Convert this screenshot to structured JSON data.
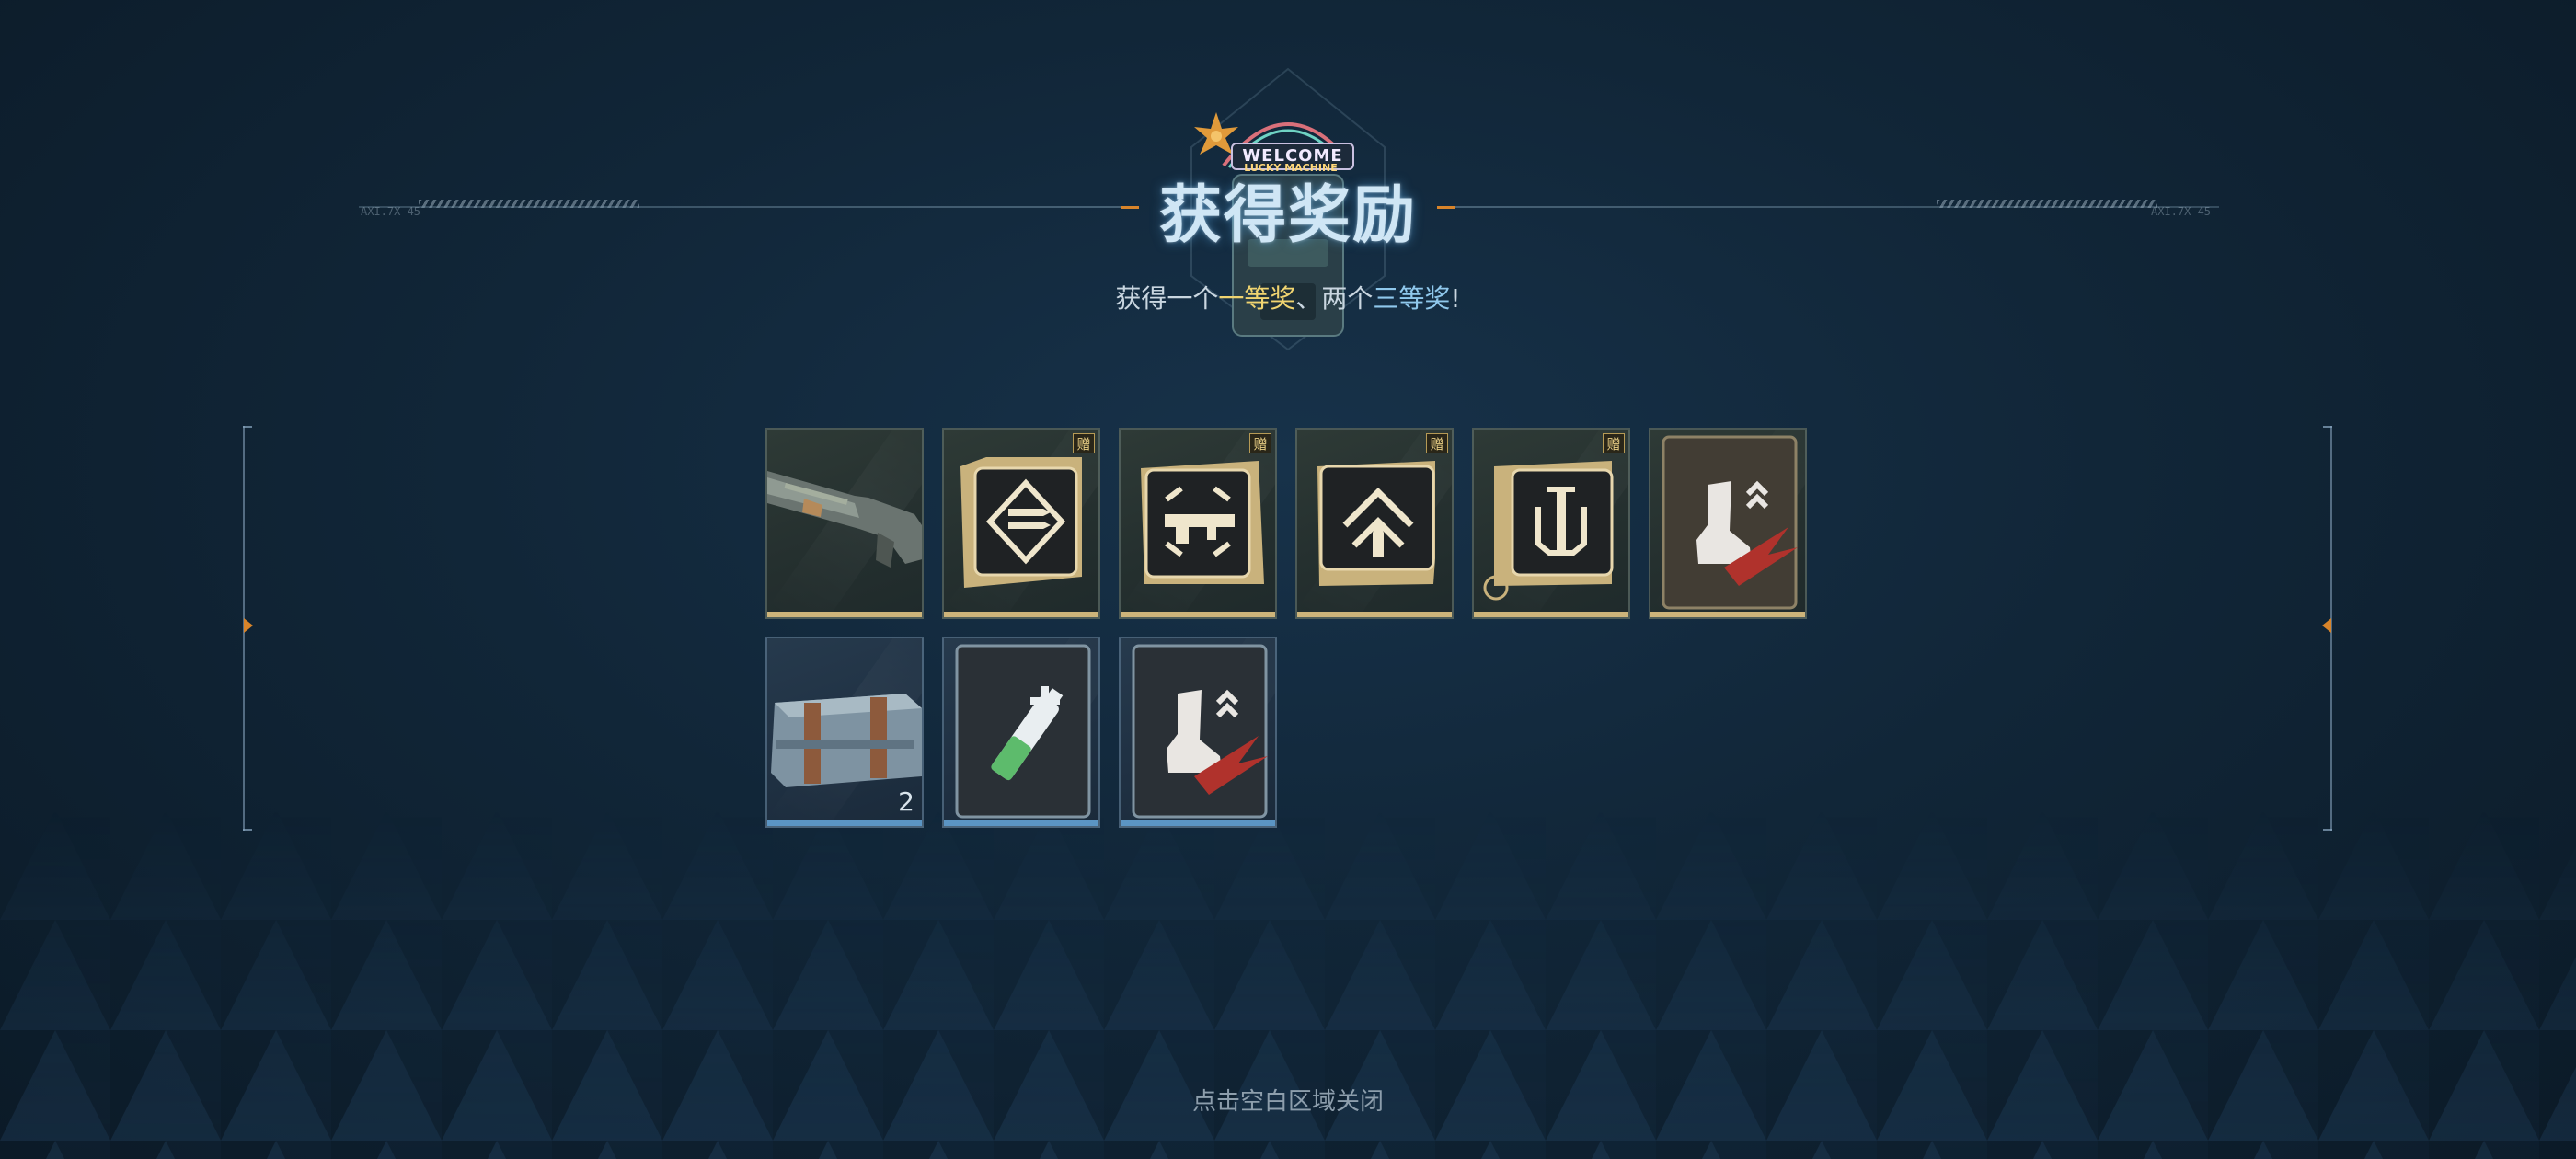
{
  "emblem": {
    "sign_text": "WELCOME",
    "sub_text": "LUCKY MACHINE"
  },
  "header": {
    "title": "获得奖励",
    "left_code": "AXI.7X-45",
    "right_code": "AXI.7X-45",
    "subtitle": {
      "prefix": "获得一个",
      "first_prize": "一等奖",
      "middle": "、两个",
      "third_prize": "三等奖",
      "suffix": "!"
    }
  },
  "rewards": {
    "row1": [
      {
        "name": "rifle",
        "icon": "rifle-icon",
        "rarity": "gold",
        "gift": ""
      },
      {
        "name": "ammo-mod-card",
        "icon": "ammo-diamond-icon",
        "rarity": "gold",
        "gift": "赠"
      },
      {
        "name": "weapon-mod-card",
        "icon": "gun-burst-icon",
        "rarity": "gold",
        "gift": "赠"
      },
      {
        "name": "bullet-mod-card",
        "icon": "bullet-chevron-icon",
        "rarity": "gold",
        "gift": "赠"
      },
      {
        "name": "syringe-mod-card",
        "icon": "syringe-icon",
        "rarity": "gold",
        "gift": "赠"
      },
      {
        "name": "boot-upgrade-card",
        "icon": "boot-speed-icon",
        "rarity": "gold",
        "gift": ""
      }
    ],
    "row2": [
      {
        "name": "supply-crate",
        "icon": "crate-icon",
        "rarity": "blue",
        "quantity": "2"
      },
      {
        "name": "health-injector",
        "icon": "health-injector-icon",
        "rarity": "blue",
        "quantity": ""
      },
      {
        "name": "boot-upgrade-card",
        "icon": "boot-speed-icon",
        "rarity": "blue",
        "quantity": ""
      }
    ]
  },
  "footer": {
    "close_hint": "点击空白区域关闭"
  },
  "colors": {
    "gold_rarity": "#cdb47a",
    "blue_rarity": "#5b95c4",
    "accent_orange": "#d8842a",
    "highlight_yellow": "#f0d470",
    "highlight_blue": "#8fc8ec"
  }
}
